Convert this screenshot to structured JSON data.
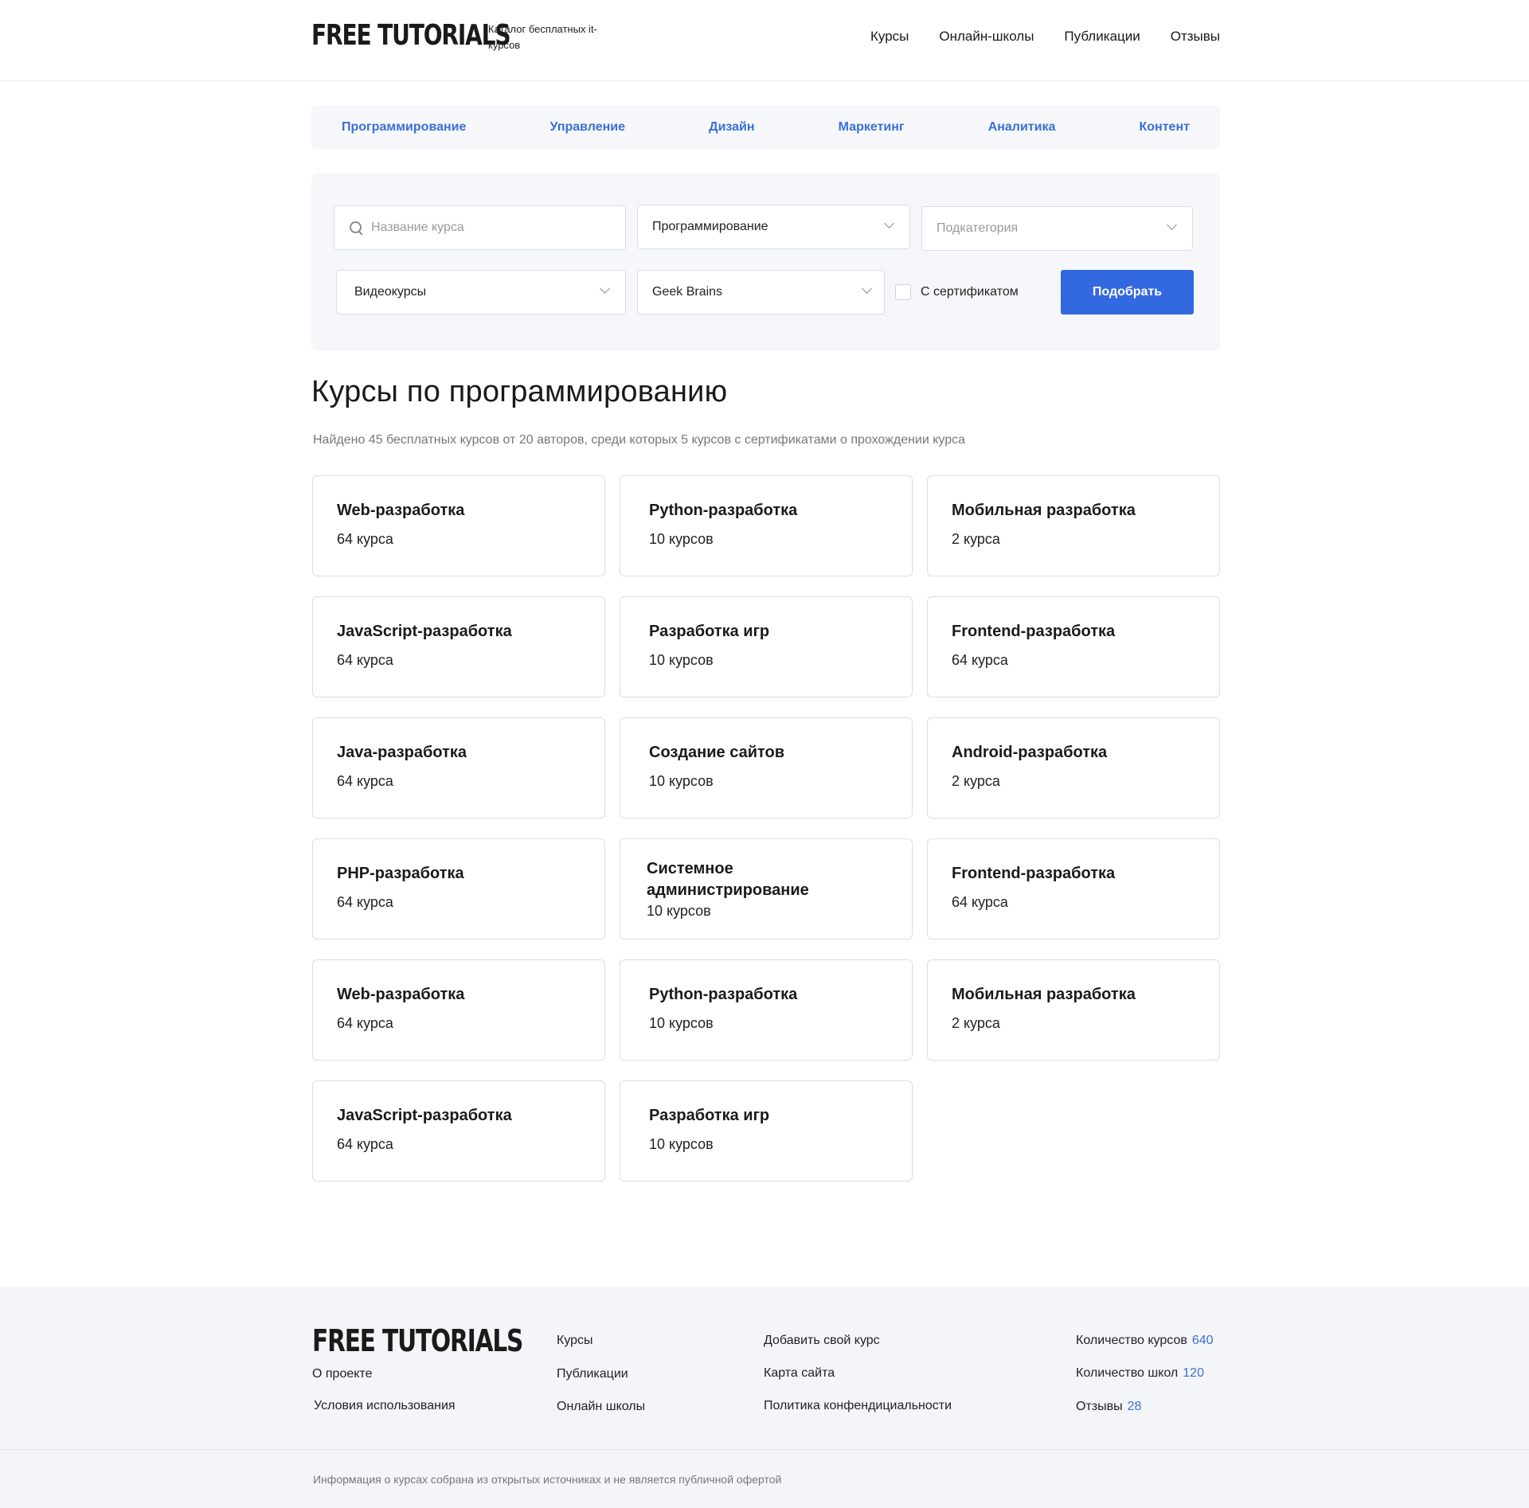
{
  "header": {
    "logo": "FREE TUTORIALS",
    "tagline": "Каталог бесплатных it-курсов",
    "nav": [
      "Курсы",
      "Онлайн-школы",
      "Публикации",
      "Отзывы"
    ]
  },
  "categories": [
    "Программирование",
    "Управление",
    "Дизайн",
    "Маркетинг",
    "Аналитика",
    "Контент"
  ],
  "filters": {
    "search_placeholder": "Название курса",
    "category": "Программирование",
    "subcategory_placeholder": "Подкатегория",
    "format": "Видеокурсы",
    "school": "Geek Brains",
    "certificate_label": "С сертификатом",
    "submit_label": "Подобрать"
  },
  "main": {
    "title": "Курсы по программированию",
    "summary": "Найдено 45 бесплатных курсов от 20 авторов,  среди которых 5 курсов с сертификатами о прохождении курса"
  },
  "cards": [
    {
      "title": "Web-разработка",
      "count": "64 курса"
    },
    {
      "title": "Python-разработка",
      "count": "10 курсов"
    },
    {
      "title": "Мобильная разработка",
      "count": "2 курса"
    },
    {
      "title": "JavaScript-разработка",
      "count": "64 курса"
    },
    {
      "title": "Разработка игр",
      "count": "10 курсов"
    },
    {
      "title": "Frontend-разработка",
      "count": "64 курса"
    },
    {
      "title": "Java-разработка",
      "count": "64 курса"
    },
    {
      "title": "Создание сайтов",
      "count": "10 курсов"
    },
    {
      "title": "Android-разработка",
      "count": "2 курса"
    },
    {
      "title": "PHP-разработка",
      "count": "64 курса"
    },
    {
      "title": "Системное администрирование",
      "count": "10 курсов"
    },
    {
      "title": "Frontend-разработка",
      "count": "64 курса"
    },
    {
      "title": "Web-разработка",
      "count": "64 курса"
    },
    {
      "title": "Python-разработка",
      "count": "10 курсов"
    },
    {
      "title": "Мобильная разработка",
      "count": "2 курса"
    },
    {
      "title": "JavaScript-разработка",
      "count": "64 курса"
    },
    {
      "title": "Разработка игр",
      "count": "10 курсов"
    }
  ],
  "footer": {
    "logo": "FREE TUTORIALS",
    "col1": [
      "О проекте",
      "Условия использования"
    ],
    "col2": [
      "Курсы",
      "Публикации",
      "Онлайн школы"
    ],
    "col3": [
      "Добавить свой курс",
      "Карта сайта",
      "Политика конфендициальности"
    ],
    "stats": [
      {
        "label": "Количество курсов",
        "value": "640"
      },
      {
        "label": "Количество школ",
        "value": "120"
      },
      {
        "label": "Отзывы",
        "value": "28"
      }
    ],
    "disclaimer": "Информация о курсах собрана из открытых источниках и не является публичной офертой"
  },
  "colors": {
    "accent": "#3369e0",
    "link": "#3b6fd8",
    "panel": "#f6f7fa",
    "footer_bg": "#f4f5f9"
  }
}
